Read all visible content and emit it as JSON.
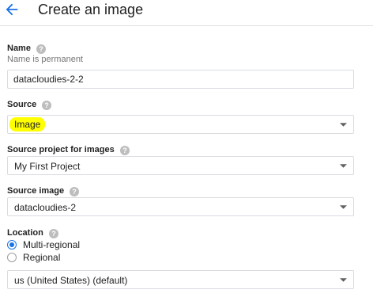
{
  "header": {
    "title": "Create an image"
  },
  "name_field": {
    "label": "Name",
    "helper": "Name is permanent",
    "value": "datacloudies-2-2"
  },
  "source_field": {
    "label": "Source",
    "value": "Image"
  },
  "source_project_field": {
    "label": "Source project for images",
    "value": "My First Project"
  },
  "source_image_field": {
    "label": "Source image",
    "value": "datacloudies-2"
  },
  "location_field": {
    "label": "Location",
    "options": [
      {
        "label": "Multi-regional",
        "checked": true
      },
      {
        "label": "Regional",
        "checked": false
      }
    ],
    "region_value": "us (United States) (default)"
  },
  "colors": {
    "accent": "#1a73e8",
    "highlight": "#ffff00",
    "muted": "#757575",
    "border": "#dadce0"
  },
  "icons": {
    "back": "arrow-back-icon",
    "help": "help-icon",
    "dropdown": "dropdown-arrow-icon"
  }
}
